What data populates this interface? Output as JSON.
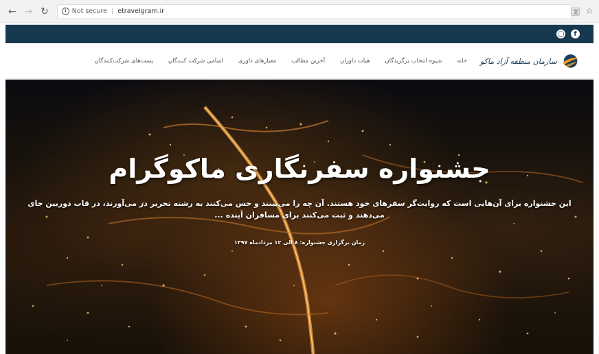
{
  "browser": {
    "back_icon": "back-arrow-icon",
    "forward_icon": "forward-arrow-icon",
    "reload_icon": "reload-icon",
    "security_label": "Not secure",
    "url": "etravelgram.ir"
  },
  "site": {
    "colors": {
      "topbar": "#16394f",
      "brand": "#1c3e5c",
      "logo_orange": "#f0a020"
    },
    "logo_text": "سازمان منطقه آزاد ماکو",
    "social_icons": [
      "facebook-icon",
      "instagram-icon"
    ],
    "nav": {
      "items": [
        "خانه",
        "شیوه انتخاب برگزیدگان",
        "هیات داوران",
        "آخرین مطالب",
        "معیارهای داوری",
        "اسامی شرکت کنندگان",
        "پست‌های شرکت‌کنندگان"
      ]
    },
    "hero": {
      "title": "جشنواره سفرنگاری ماکوگرام",
      "description": "این جشنواره برای آن‌هایی است که روایت‌گر سفرهای خود هستند. آن چه را می‌بینند و حس می‌کنند به رشته تحریر در می‌آورند، در قاب دوربین جای می‌دهند و ثبت می‌کنند برای مسافران آینده ...",
      "date": "زمان برگزاری جشنواره: ۸ الی ۱۲ مردادماه ۱۳۹۷"
    }
  }
}
